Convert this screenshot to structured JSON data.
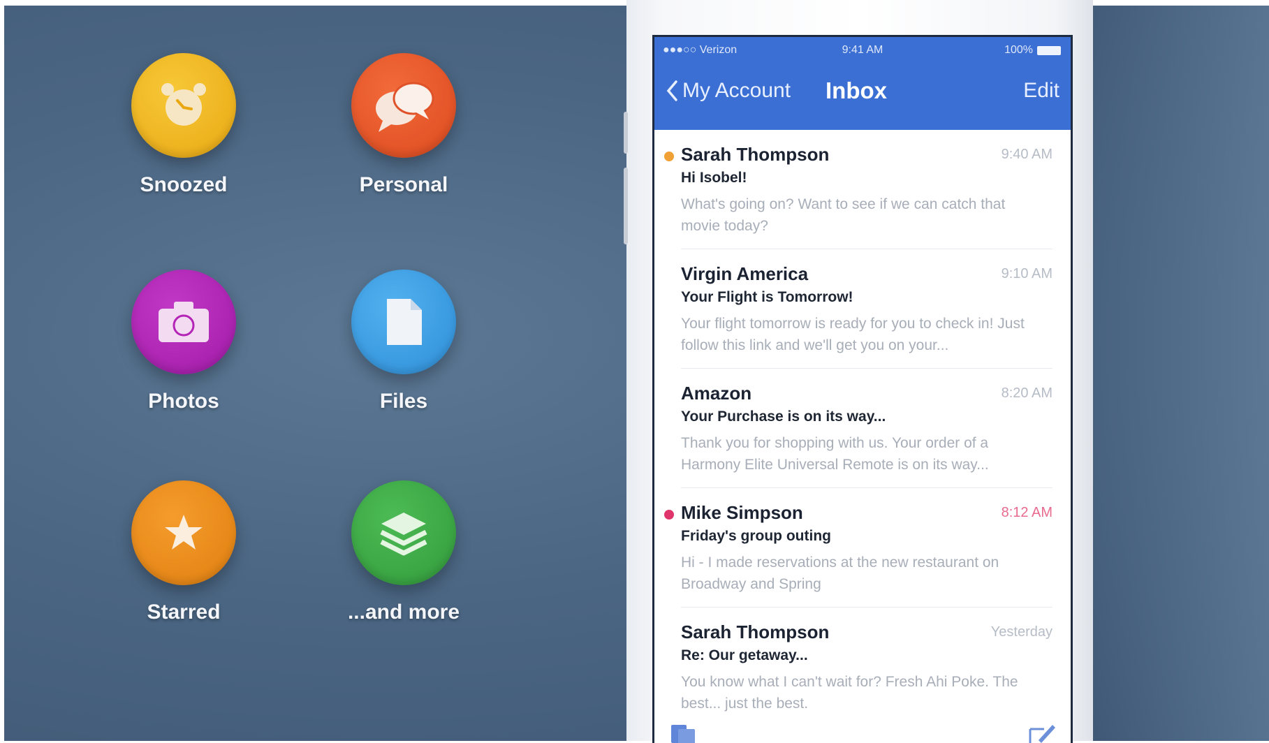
{
  "features": [
    {
      "label": "Snoozed",
      "icon": "alarm-clock-icon",
      "color": "#f2b51c"
    },
    {
      "label": "Personal",
      "icon": "chat-bubbles-icon",
      "color": "#ec5a2a"
    },
    {
      "label": "Photos",
      "icon": "camera-icon",
      "color": "#b324b7"
    },
    {
      "label": "Files",
      "icon": "document-icon",
      "color": "#3e9ee4"
    },
    {
      "label": "Starred",
      "icon": "star-icon",
      "color": "#f08c1a"
    },
    {
      "label": "...and more",
      "icon": "layers-icon",
      "color": "#3fad48"
    }
  ],
  "status_bar": {
    "carrier": "●●●○○ Verizon",
    "time": "9:41 AM",
    "battery": "100%"
  },
  "nav": {
    "back_label": "My Account",
    "title": "Inbox",
    "edit_label": "Edit"
  },
  "colors": {
    "nav_blue": "#3b6fd4",
    "unread_orange": "#f0a034",
    "unread_pink": "#e0356c"
  },
  "messages": [
    {
      "sender": "Sarah Thompson",
      "time": "9:40 AM",
      "subject": "Hi Isobel!",
      "preview": "What's going on? Want to see if we can catch that movie today?",
      "dot": "orange"
    },
    {
      "sender": "Virgin America",
      "time": "9:10 AM",
      "subject": "Your Flight is Tomorrow!",
      "preview": "Your flight tomorrow is ready for you to check in! Just follow this link and we'll get you on your...",
      "dot": ""
    },
    {
      "sender": "Amazon",
      "time": "8:20 AM",
      "subject": "Your Purchase is on its way...",
      "preview": "Thank you for shopping with us. Your order of a Harmony Elite Universal Remote is on its way...",
      "dot": ""
    },
    {
      "sender": "Mike Simpson",
      "time": "8:12 AM",
      "subject": "Friday's group outing",
      "preview": "Hi - I made reservations at the new restaurant on Broadway and Spring",
      "dot": "pink"
    },
    {
      "sender": "Sarah Thompson",
      "time": "Yesterday",
      "subject": "Re: Our getaway...",
      "preview": "You know what I can't wait for? Fresh Ahi Poke. The best... just the best.",
      "dot": ""
    }
  ],
  "toolbar": {
    "left_icon": "folders-icon",
    "right_icon": "compose-icon"
  }
}
